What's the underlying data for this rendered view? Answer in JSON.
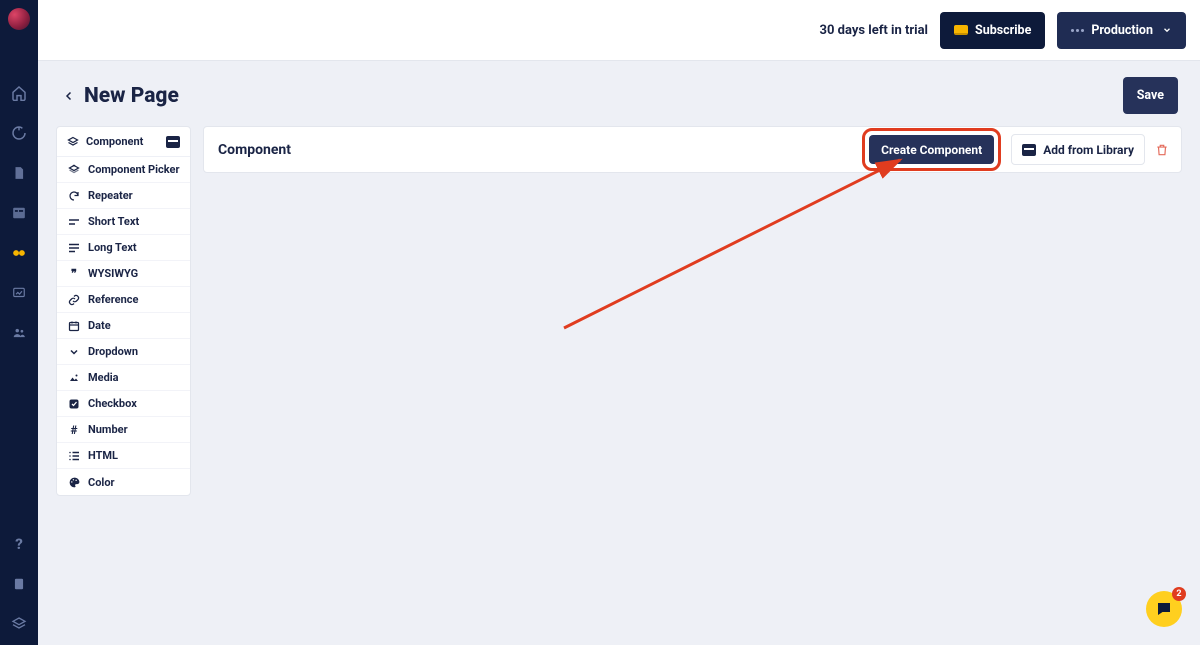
{
  "topbar": {
    "trial_text": "30 days left in trial",
    "subscribe_label": "Subscribe",
    "environment_label": "Production"
  },
  "page": {
    "title": "New Page",
    "save_label": "Save"
  },
  "fields_panel": {
    "header": "Component",
    "items": [
      {
        "icon": "layers",
        "label": "Component Picker"
      },
      {
        "icon": "repeat",
        "label": "Repeater"
      },
      {
        "icon": "short",
        "label": "Short Text"
      },
      {
        "icon": "long",
        "label": "Long Text"
      },
      {
        "icon": "quote",
        "label": "WYSIWYG"
      },
      {
        "icon": "link",
        "label": "Reference"
      },
      {
        "icon": "cal",
        "label": "Date"
      },
      {
        "icon": "chev",
        "label": "Dropdown"
      },
      {
        "icon": "img",
        "label": "Media"
      },
      {
        "icon": "check",
        "label": "Checkbox"
      },
      {
        "icon": "hash",
        "label": "Number"
      },
      {
        "icon": "list",
        "label": "HTML"
      },
      {
        "icon": "pal",
        "label": "Color"
      }
    ]
  },
  "component_card": {
    "title": "Component",
    "create_label": "Create Component",
    "library_label": "Add from Library"
  },
  "chat": {
    "badge": "2"
  }
}
